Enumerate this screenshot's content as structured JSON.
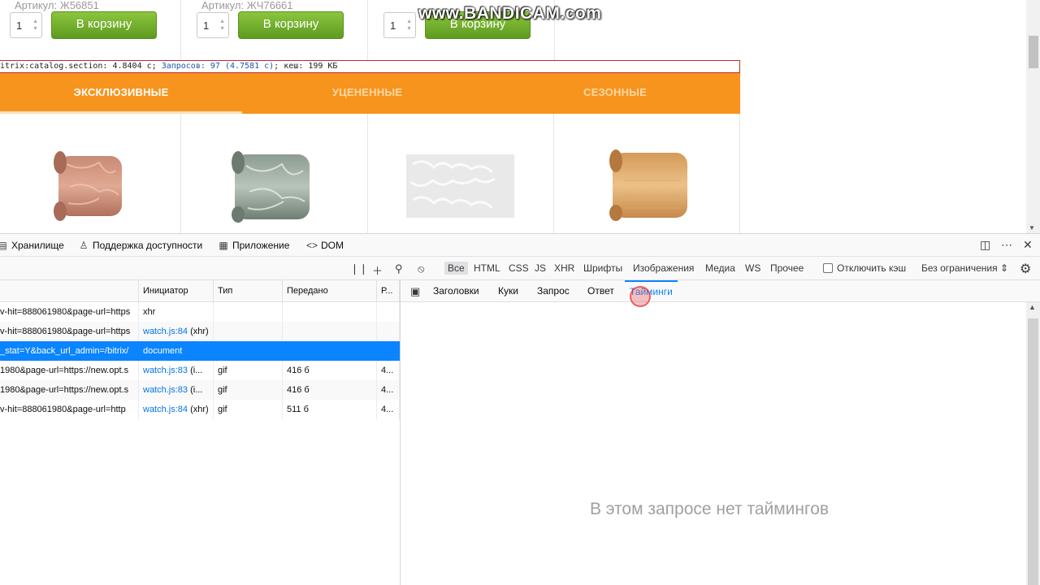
{
  "watermark": "www.BANDICAM.com",
  "products_top": [
    {
      "article": "Артикул: Ж56851",
      "qty": "1",
      "button": "В корзину"
    },
    {
      "article": "Артикул: ЖЧ76661",
      "qty": "1",
      "button": "В корзину"
    },
    {
      "article": "Артикул: Ж...",
      "qty": "1",
      "button": "В корзину"
    }
  ],
  "debug": {
    "text": "itrix:catalog.section: 4.8404 с; ",
    "queries": "Запросов: 97 (4.7581 с)",
    "cache": "; кеш: 199 КБ"
  },
  "category_tabs": [
    {
      "label": "ЭКСКЛЮЗИВНЫЕ",
      "active": true
    },
    {
      "label": "УЦЕНЕННЫЕ",
      "active": false
    },
    {
      "label": "СЕЗОННЫЕ",
      "active": false
    }
  ],
  "products_images": [
    {
      "name": "roll-pink-marble"
    },
    {
      "name": "roll-green-marble"
    },
    {
      "name": "sheet-white-pattern"
    },
    {
      "name": "roll-light-wood"
    }
  ],
  "devtools": {
    "toolbar": {
      "storage": "Хранилище",
      "accessibility": "Поддержка доступности",
      "application": "Приложение",
      "dom": "DOM"
    },
    "filters": [
      "Все",
      "HTML",
      "CSS",
      "JS",
      "XHR",
      "Шрифты",
      "Изображения",
      "Медиа",
      "WS",
      "Прочее"
    ],
    "disable_cache": "Отключить кэш",
    "throttle": "Без ограничения ⇕",
    "columns": {
      "initiator": "Инициатор",
      "type": "Тип",
      "transferred": "Передано",
      "size": "Р..."
    },
    "rows": [
      {
        "url": "v-hit=888061980&page-url=https",
        "initiator": "xhr",
        "initiator_src": "",
        "type": "",
        "transferred": "",
        "size": ""
      },
      {
        "url": "v-hit=888061980&page-url=https",
        "initiator": "watch.js:84",
        "initiator_src": " (xhr)",
        "type": "",
        "transferred": "",
        "size": ""
      },
      {
        "url": "_stat=Y&back_url_admin=/bitrix/",
        "initiator": "document",
        "initiator_src": "",
        "type": "",
        "transferred": "",
        "size": ""
      },
      {
        "url": "1980&page-url=https://new.opt.s",
        "initiator": "watch.js:83",
        "initiator_src": " (i...",
        "type": "gif",
        "transferred": "416 б",
        "size": "4..."
      },
      {
        "url": "1980&page-url=https://new.opt.s",
        "initiator": "watch.js:83",
        "initiator_src": " (i...",
        "type": "gif",
        "transferred": "416 б",
        "size": "4..."
      },
      {
        "url": "v-hit=888061980&page-url=http",
        "initiator": "watch.js:84",
        "initiator_src": " (xhr)",
        "type": "gif",
        "transferred": "511 б",
        "size": "4..."
      }
    ],
    "detail_tabs": [
      "Заголовки",
      "Куки",
      "Запрос",
      "Ответ",
      "Тайминги"
    ],
    "detail_empty": "В этом запросе нет таймингов"
  }
}
